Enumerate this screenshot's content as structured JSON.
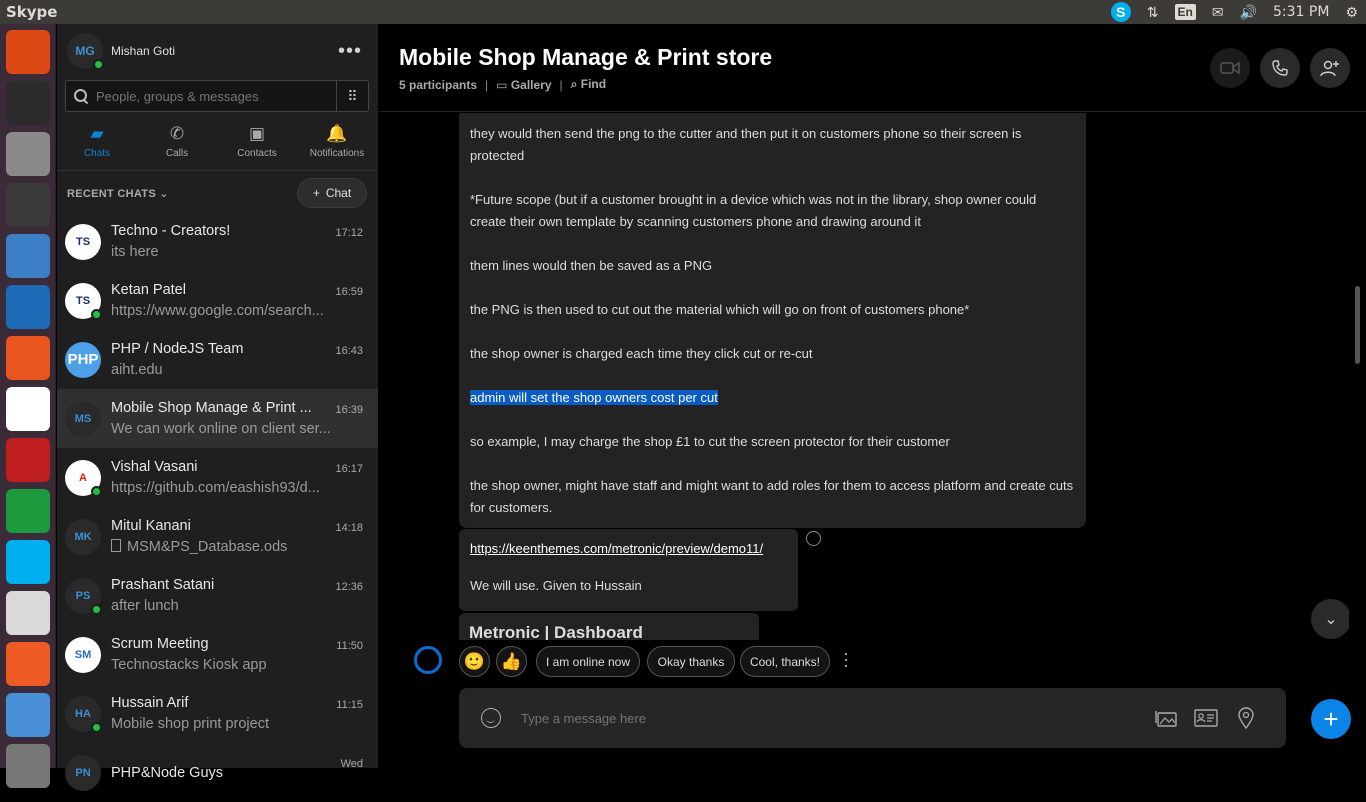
{
  "system": {
    "app_title": "Skype",
    "lang": "En",
    "clock": "5:31 PM"
  },
  "launcher": {
    "apps": [
      {
        "name": "ubuntu-dash-icon",
        "color": "#dd4814"
      },
      {
        "name": "terminal-icon",
        "color": "#2b2b2b"
      },
      {
        "name": "file-manager-icon",
        "color": "#8a8a8a"
      },
      {
        "name": "sublime-text-icon",
        "color": "#3a3a3a"
      },
      {
        "name": "document-viewer-icon",
        "color": "#3d7fc6"
      },
      {
        "name": "vscode-icon",
        "color": "#1e6bb8"
      },
      {
        "name": "firefox-icon",
        "color": "#e8551f"
      },
      {
        "name": "chrome-icon",
        "color": "#ffffff"
      },
      {
        "name": "filezilla-icon",
        "color": "#bf1e1e"
      },
      {
        "name": "spreadsheet-icon",
        "color": "#1d9a3e"
      },
      {
        "name": "skype-icon",
        "color": "#00aff0"
      },
      {
        "name": "pdf-reader-icon",
        "color": "#d9d9d9"
      },
      {
        "name": "postman-icon",
        "color": "#ef5b25"
      },
      {
        "name": "mail-client-icon",
        "color": "#4a90d9"
      },
      {
        "name": "trash-icon",
        "color": "#777777"
      }
    ]
  },
  "profile": {
    "initials": "MG",
    "name": "Mishan Goti"
  },
  "search": {
    "placeholder": "People, groups & messages"
  },
  "nav": {
    "tabs": [
      {
        "label": "Chats",
        "icon": "chat-bubble-icon"
      },
      {
        "label": "Calls",
        "icon": "phone-icon"
      },
      {
        "label": "Contacts",
        "icon": "contacts-icon"
      },
      {
        "label": "Notifications",
        "icon": "bell-icon"
      }
    ]
  },
  "recent": {
    "label": "RECENT CHATS",
    "new_chat_label": "Chat"
  },
  "chats": [
    {
      "name": "Techno - Creators!",
      "last": "its here",
      "time": "17:12",
      "initials": "TS",
      "avatar_bg": "#ffffff",
      "avatar_fg": "#1a2a6c",
      "online": false
    },
    {
      "name": "Ketan Patel",
      "last": "https://www.google.com/search...",
      "time": "16:59",
      "initials": "TS",
      "avatar_bg": "#ffffff",
      "avatar_fg": "#1a2a6c",
      "online": true
    },
    {
      "name": "PHP / NodeJS Team",
      "last": "aiht.edu",
      "time": "16:43",
      "initials": "PHP",
      "avatar_bg": "#4d9fe8",
      "avatar_fg": "#ffffff",
      "online": false
    },
    {
      "name": "Mobile Shop Manage & Print ...",
      "last": "We can work online on client ser...",
      "time": "16:39",
      "initials": "MS",
      "avatar_bg": "#2a2a2a",
      "avatar_fg": "#3d8fd6",
      "online": false
    },
    {
      "name": "Vishal Vasani",
      "last": "https://github.com/eashish93/d...",
      "time": "16:17",
      "initials": "A",
      "avatar_bg": "#ffffff",
      "avatar_fg": "#dd1b16",
      "online": true
    },
    {
      "name": "Mitul Kanani",
      "last": "MSM&PS_Database.ods",
      "time": "14:18",
      "initials": "MK",
      "avatar_bg": "#2a2a2a",
      "avatar_fg": "#3d8fd6",
      "online": false
    },
    {
      "name": "Prashant Satani",
      "last": "after lunch",
      "time": "12:36",
      "initials": "PS",
      "avatar_bg": "#2a2a2a",
      "avatar_fg": "#3d8fd6",
      "online": true
    },
    {
      "name": "Scrum Meeting",
      "last": "Technostacks Kiosk app",
      "time": "11:50",
      "initials": "SM",
      "avatar_bg": "#ffffff",
      "avatar_fg": "#2a6cc4",
      "online": false
    },
    {
      "name": "Hussain Arif",
      "last": "Mobile shop print project",
      "time": "11:15",
      "initials": "HA",
      "avatar_bg": "#2a2a2a",
      "avatar_fg": "#3d8fd6",
      "online": true
    },
    {
      "name": "PHP&Node Guys",
      "last": "",
      "time": "Wed",
      "initials": "PN",
      "avatar_bg": "#2a2a2a",
      "avatar_fg": "#3d8fd6",
      "online": false
    }
  ],
  "conversation": {
    "title": "Mobile Shop Manage & Print store",
    "participants": "5 participants",
    "gallery": "Gallery",
    "find": "Find"
  },
  "messages": {
    "main": [
      "they would then send the png to the cutter and then put it on customers phone so their screen is protected",
      "*Future scope (but if a customer brought in a device which was not in the library, shop owner could create their own template by scanning customers phone and drawing around it",
      "them lines would then be saved as a PNG",
      "the PNG is then used to cut out the material which will go on front of customers phone*",
      "the shop owner is charged each time they click cut or re-cut",
      "admin will set the shop owners cost per cut",
      "so example, I may charge the shop £1 to cut the screen protector for their customer",
      "the shop owner, might have staff and might want to add roles for them to access platform and create cuts for customers."
    ],
    "link": "https://keenthemes.com/metronic/preview/demo11/",
    "link_followup": "We will use. Given to Hussain",
    "preview_title": "Metronic | Dashboard"
  },
  "quick_replies": [
    "I am online now",
    "Okay thanks",
    "Cool, thanks!"
  ],
  "composer": {
    "placeholder": "Type a message here"
  }
}
